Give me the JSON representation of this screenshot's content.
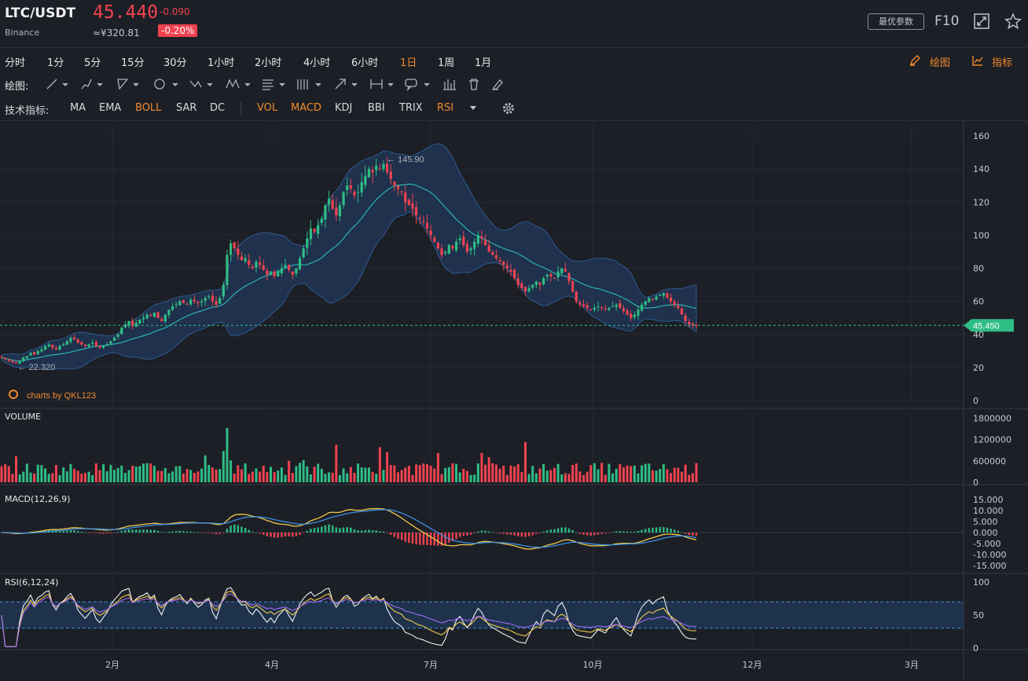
{
  "header": {
    "pair": "LTC/USDT",
    "exchange": "Binance",
    "price": "45.440",
    "change": "-0.090",
    "cny_price": "≈¥320.81",
    "change_pct": "-0.20%",
    "optimal_params_label": "最优参数",
    "f10_label": "F10",
    "icons": [
      "expand-icon",
      "star-icon"
    ]
  },
  "timeframes": {
    "items": [
      "分时",
      "1分",
      "5分",
      "15分",
      "30分",
      "1小时",
      "2小时",
      "4小时",
      "6小时",
      "1日",
      "1周",
      "1月"
    ],
    "active": "1日",
    "draw_label": "绘图",
    "indicator_label": "指标"
  },
  "drawing_tools": {
    "label": "绘图:",
    "icons": [
      "line-tool-icon",
      "pen-tool-icon",
      "angle-tool-icon",
      "circle-tool-icon",
      "cross-tool-icon",
      "pattern-tool-icon",
      "fib-tool-icon",
      "parallel-tool-icon",
      "arrow-tool-icon",
      "range-tool-icon",
      "comment-tool-icon",
      "bars-icon",
      "trash-icon",
      "eraser-icon"
    ]
  },
  "indicators": {
    "label": "技术指标:",
    "main": [
      "MA",
      "EMA",
      "BOLL",
      "SAR",
      "DC"
    ],
    "sub": [
      "VOL",
      "MACD",
      "KDJ",
      "BBI",
      "TRIX",
      "RSI"
    ],
    "active": [
      "BOLL",
      "VOL",
      "MACD",
      "RSI"
    ]
  },
  "colors": {
    "up": "#2ebd85",
    "down": "#f0434f",
    "accent": "#f08a2d",
    "boll_fill": "#22406b",
    "boll_mid": "#2bb3b0",
    "macd_dif": "#f2c94c",
    "macd_dea": "#3d8fe0",
    "rsi6": "#f0f0f0",
    "rsi12": "#f2c94c",
    "rsi24": "#9b6cf0",
    "price_line": "#2ebd85"
  },
  "chart_data": [
    {
      "type": "candlestick",
      "title": "",
      "watermark": "charts by QKL123",
      "ylim": [
        0,
        165
      ],
      "yticks": [
        "160",
        "140",
        "120",
        "100",
        "80",
        "60",
        "40",
        "20",
        "0"
      ],
      "xticks": [
        "2月",
        "4月",
        "7月",
        "10月",
        "12月",
        "3月"
      ],
      "high_annotation": "145.90",
      "low_annotation": "22.320",
      "current_price_tag": "45.450",
      "close_series": [
        26,
        25,
        24,
        23,
        22.5,
        24,
        26,
        27,
        29,
        28,
        30,
        31,
        33,
        34,
        32,
        31,
        33,
        34,
        36,
        38,
        37,
        35,
        34,
        33,
        34,
        35,
        33,
        32,
        33,
        34,
        36,
        38,
        40,
        44,
        46,
        48,
        45,
        47,
        49,
        50,
        52,
        51,
        53,
        50,
        48,
        52,
        55,
        57,
        58,
        60,
        59,
        58,
        61,
        60,
        59,
        60,
        62,
        63,
        60,
        58,
        62,
        70,
        88,
        95,
        92,
        88,
        85,
        86,
        82,
        80,
        84,
        82,
        79,
        76,
        78,
        75,
        78,
        80,
        82,
        79,
        76,
        80,
        86,
        92,
        98,
        104,
        102,
        106,
        110,
        118,
        122,
        116,
        112,
        118,
        126,
        130,
        128,
        124,
        126,
        132,
        136,
        140,
        138,
        142,
        140,
        143,
        138,
        134,
        130,
        128,
        126,
        120,
        118,
        116,
        112,
        110,
        108,
        104,
        100,
        96,
        92,
        88,
        90,
        94,
        92,
        96,
        98,
        94,
        90,
        92,
        96,
        100,
        98,
        94,
        90,
        88,
        86,
        84,
        82,
        80,
        78,
        74,
        70,
        68,
        66,
        68,
        70,
        72,
        70,
        74,
        76,
        75,
        74,
        78,
        80,
        78,
        72,
        66,
        60,
        58,
        57,
        56,
        55,
        56,
        57,
        56,
        55,
        56,
        57,
        58,
        56,
        54,
        52,
        50,
        52,
        55,
        58,
        60,
        62,
        61,
        63,
        64,
        65,
        62,
        60,
        58,
        56,
        52,
        48,
        46,
        45.5,
        45.45
      ],
      "volume_ylim": [
        0,
        1900000
      ],
      "volume_yticks": [
        "1800000",
        "1200000",
        "600000",
        "0"
      ],
      "macd_ylim": [
        -16,
        16
      ],
      "macd_yticks": [
        "15.000",
        "10.000",
        "5.000",
        "0.000",
        "-5.000",
        "-10.000",
        "-15.000"
      ],
      "rsi_ylim": [
        0,
        100
      ],
      "rsi_yticks": [
        "100",
        "50",
        "0"
      ]
    }
  ],
  "panels": {
    "volume_title": "VOLUME",
    "macd_title": "MACD(12,26,9)",
    "rsi_title": "RSI(6,12,24)"
  }
}
